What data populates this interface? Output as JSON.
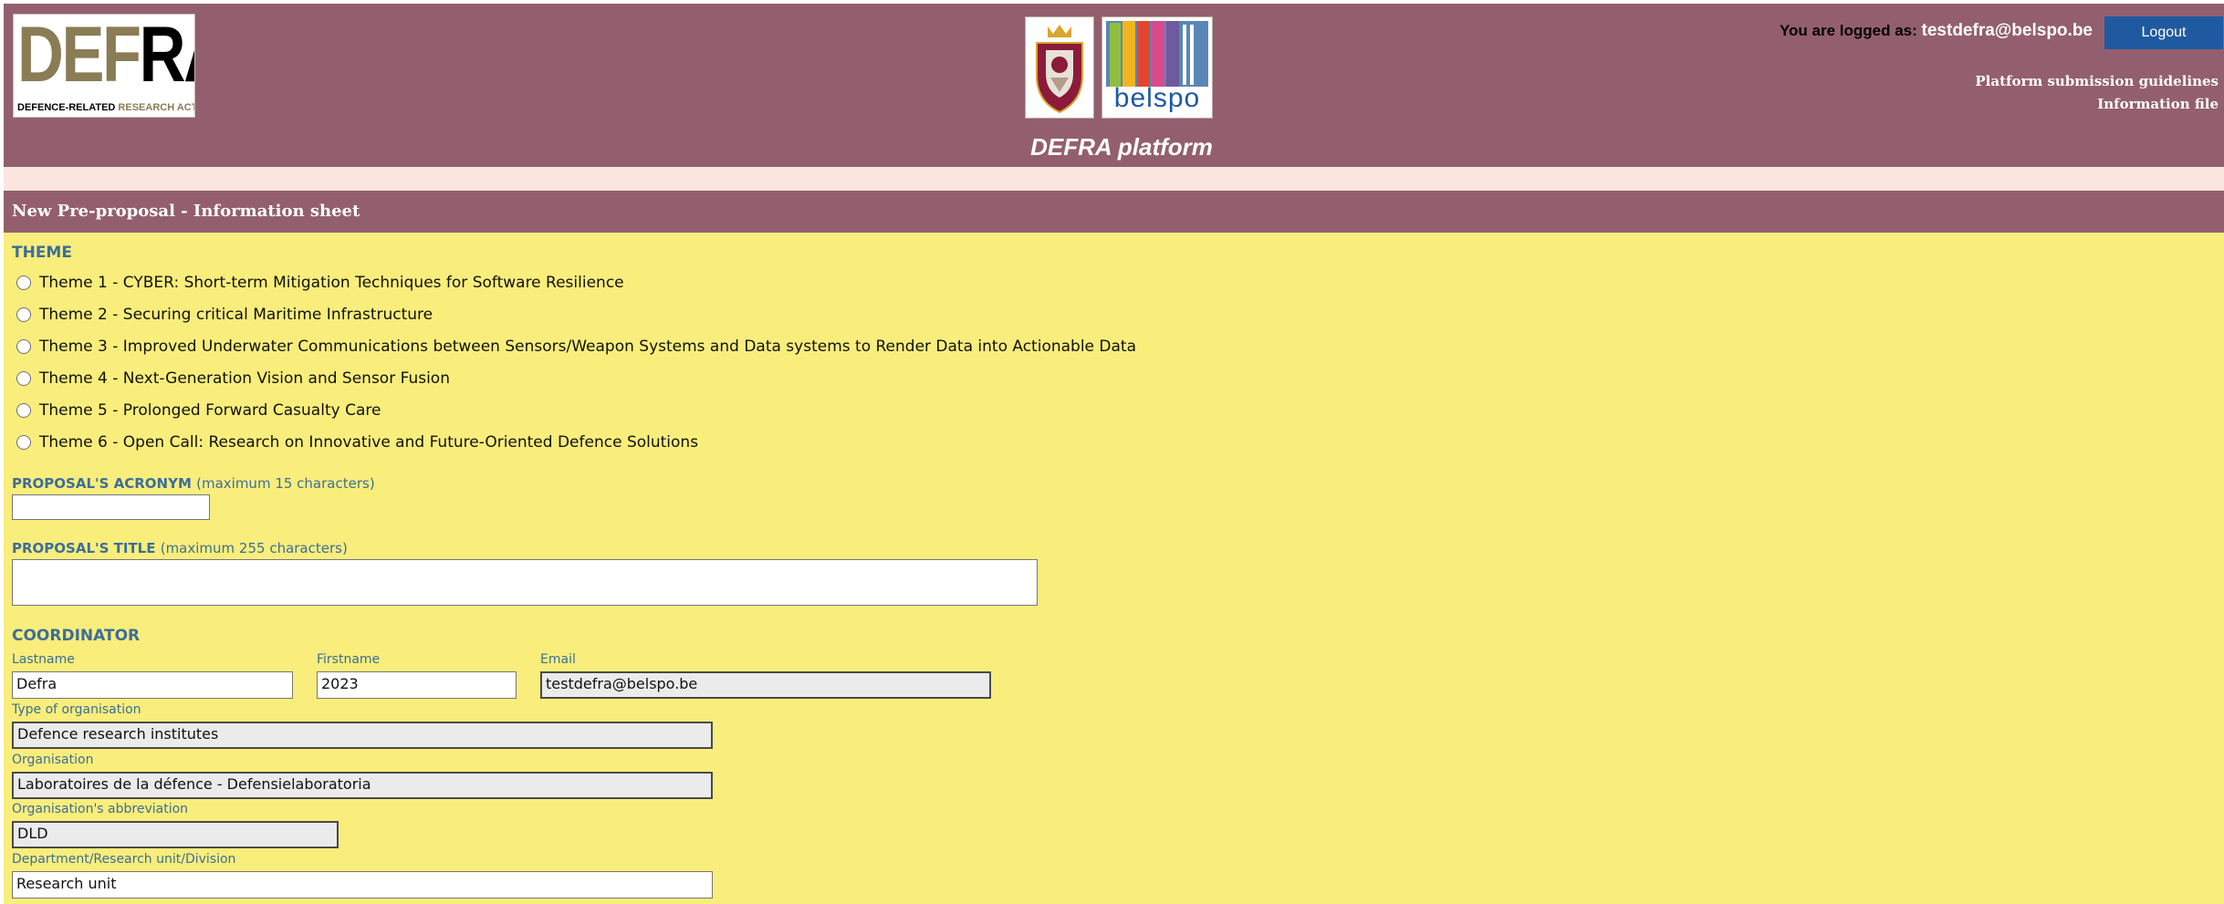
{
  "header": {
    "logo": {
      "big_text_part1": "DEF",
      "big_text_part2": "RA",
      "tagline_part1": "DEFENCE-RELATED ",
      "tagline_part2": "RESEARCH ACTION"
    },
    "belspo_logo_text": "belspo",
    "platform_title": "DEFRA platform",
    "logged_label": "You are logged as:",
    "logged_user": "testdefra@belspo.be",
    "logout_label": "Logout",
    "links": [
      "Platform submission guidelines",
      "Information file"
    ]
  },
  "section_title": "New Pre-proposal - Information sheet",
  "form": {
    "theme_heading": "THEME",
    "themes": [
      "Theme 1 - CYBER: Short-term Mitigation Techniques for Software Resilience",
      "Theme 2 - Securing critical Maritime Infrastructure",
      "Theme 3 - Improved Underwater Communications between Sensors/Weapon Systems and Data systems to Render Data into Actionable Data",
      "Theme 4 - Next-Generation Vision and Sensor Fusion",
      "Theme 5 - Prolonged Forward Casualty Care",
      "Theme 6 - Open Call: Research on Innovative and Future-Oriented Defence Solutions"
    ],
    "acronym_label": "PROPOSAL'S ACRONYM",
    "acronym_hint": "(maximum 15 characters)",
    "acronym_value": "",
    "title_label": "PROPOSAL'S TITLE",
    "title_hint": "(maximum 255 characters)",
    "title_value": "",
    "coordinator_heading": "COORDINATOR",
    "coordinator": {
      "lastname_label": "Lastname",
      "lastname_value": "Defra",
      "firstname_label": "Firstname",
      "firstname_value": "2023",
      "email_label": "Email",
      "email_value": "testdefra@belspo.be",
      "org_type_label": "Type of organisation",
      "org_type_value": "Defence research institutes",
      "org_label": "Organisation",
      "org_value": "Laboratoires de la défence - Defensielaboratoria",
      "abbrev_label": "Organisation's abbreviation",
      "abbrev_value": "DLD",
      "dept_label": "Department/Research unit/Division",
      "dept_value": "Research unit"
    }
  },
  "colors": {
    "header_bg": "#935f6e",
    "content_bg": "#f9ee7b",
    "heading_blue": "#3d6e9a",
    "logout_bg": "#1f5aa0",
    "pink_strip": "#fbe7e0"
  }
}
